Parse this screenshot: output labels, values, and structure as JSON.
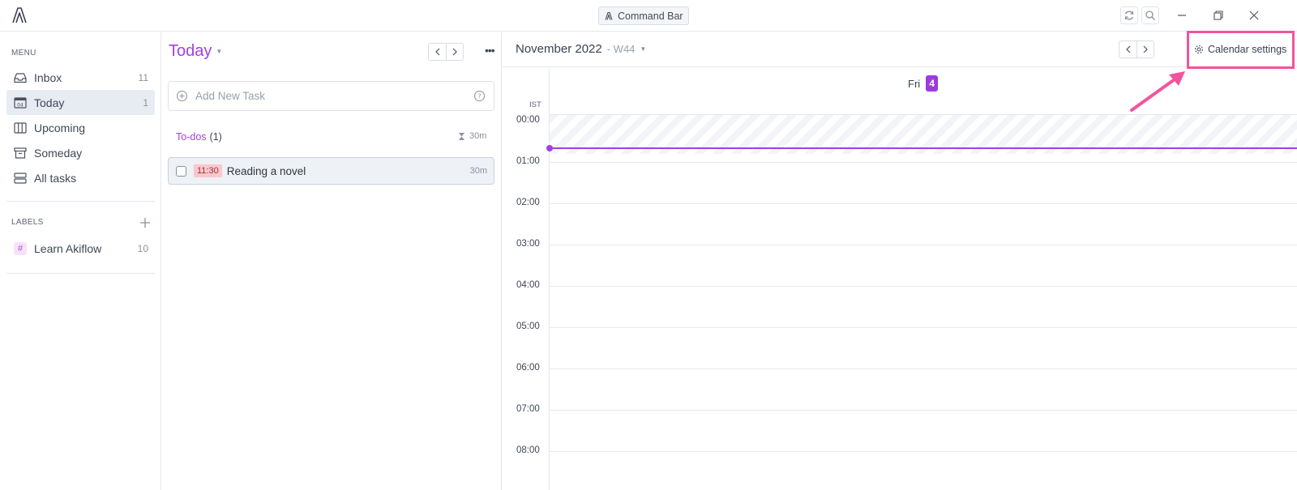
{
  "titlebar": {
    "command_bar_label": "Command Bar"
  },
  "sidebar": {
    "menu_heading": "MENU",
    "items": [
      {
        "label": "Inbox",
        "count": "11",
        "icon": "inbox-icon"
      },
      {
        "label": "Today",
        "count": "1",
        "icon": "calendar-today-icon",
        "active": true
      },
      {
        "label": "Upcoming",
        "count": "",
        "icon": "columns-icon"
      },
      {
        "label": "Someday",
        "count": "",
        "icon": "archive-icon"
      },
      {
        "label": "All tasks",
        "count": "",
        "icon": "stack-icon"
      }
    ],
    "labels_heading": "LABELS",
    "labels": [
      {
        "label": "Learn Akiflow",
        "count": "10",
        "color": "#b04cd4"
      }
    ]
  },
  "today_panel": {
    "title": "Today",
    "add_task_placeholder": "Add New Task",
    "todos_label": "To-dos",
    "todos_count": "(1)",
    "todos_duration": "30m",
    "tasks": [
      {
        "time": "11:30",
        "title": "Reading a novel",
        "duration": "30m"
      }
    ]
  },
  "calendar": {
    "month": "November 2022",
    "week": "- W44",
    "settings_label": "Calendar settings",
    "day_name": "Fri",
    "day_number": "4",
    "timezone": "IST",
    "hours": [
      "00:00",
      "01:00",
      "02:00",
      "03:00",
      "04:00",
      "05:00",
      "06:00",
      "07:00",
      "08:00"
    ]
  },
  "colors": {
    "accent": "#a53ee6",
    "highlight": "#f0559c",
    "time_badge_bg": "#f7c9cd"
  }
}
